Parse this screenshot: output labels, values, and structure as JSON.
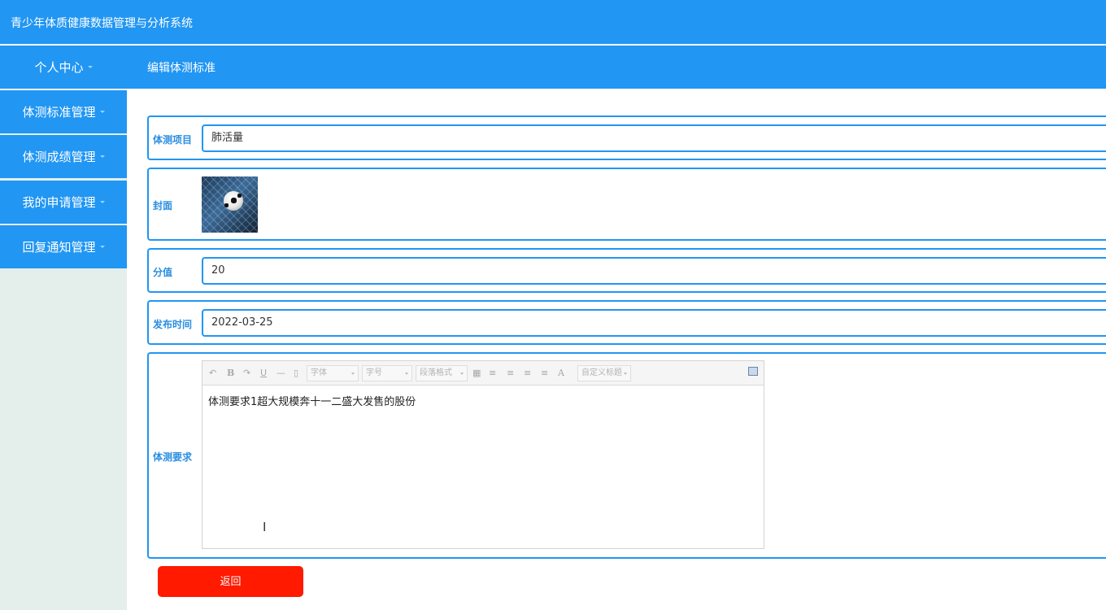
{
  "app": {
    "title": "青少年体质健康数据管理与分析系统"
  },
  "header": {
    "user_menu": "个人中心",
    "page_heading": "编辑体测标准"
  },
  "sidebar": {
    "items": [
      {
        "label": "体测标准管理"
      },
      {
        "label": "体测成绩管理"
      },
      {
        "label": "我的申请管理"
      },
      {
        "label": "回复通知管理"
      }
    ]
  },
  "form": {
    "item": {
      "label": "体测项目",
      "value": "肺活量"
    },
    "cover": {
      "label": "封面"
    },
    "score": {
      "label": "分值",
      "value": "20"
    },
    "publish_time": {
      "label": "发布时间",
      "value": "2022-03-25"
    },
    "requirement": {
      "label": "体测要求",
      "content": "体测要求1超大规模奔十一二盛大发售的股份",
      "toolbar": {
        "font_family": "字体",
        "font_size": "字号",
        "paragraph": "段落格式",
        "font_color_glyph": "A",
        "custom_title": "自定义标题",
        "bold_glyph": "B",
        "underline_glyph": "U",
        "hr_glyph": "—"
      }
    },
    "back_button": "返回"
  },
  "colors": {
    "primary": "#2196f3",
    "sidebar_bg": "#e4eeea",
    "danger": "#ff1a00"
  }
}
